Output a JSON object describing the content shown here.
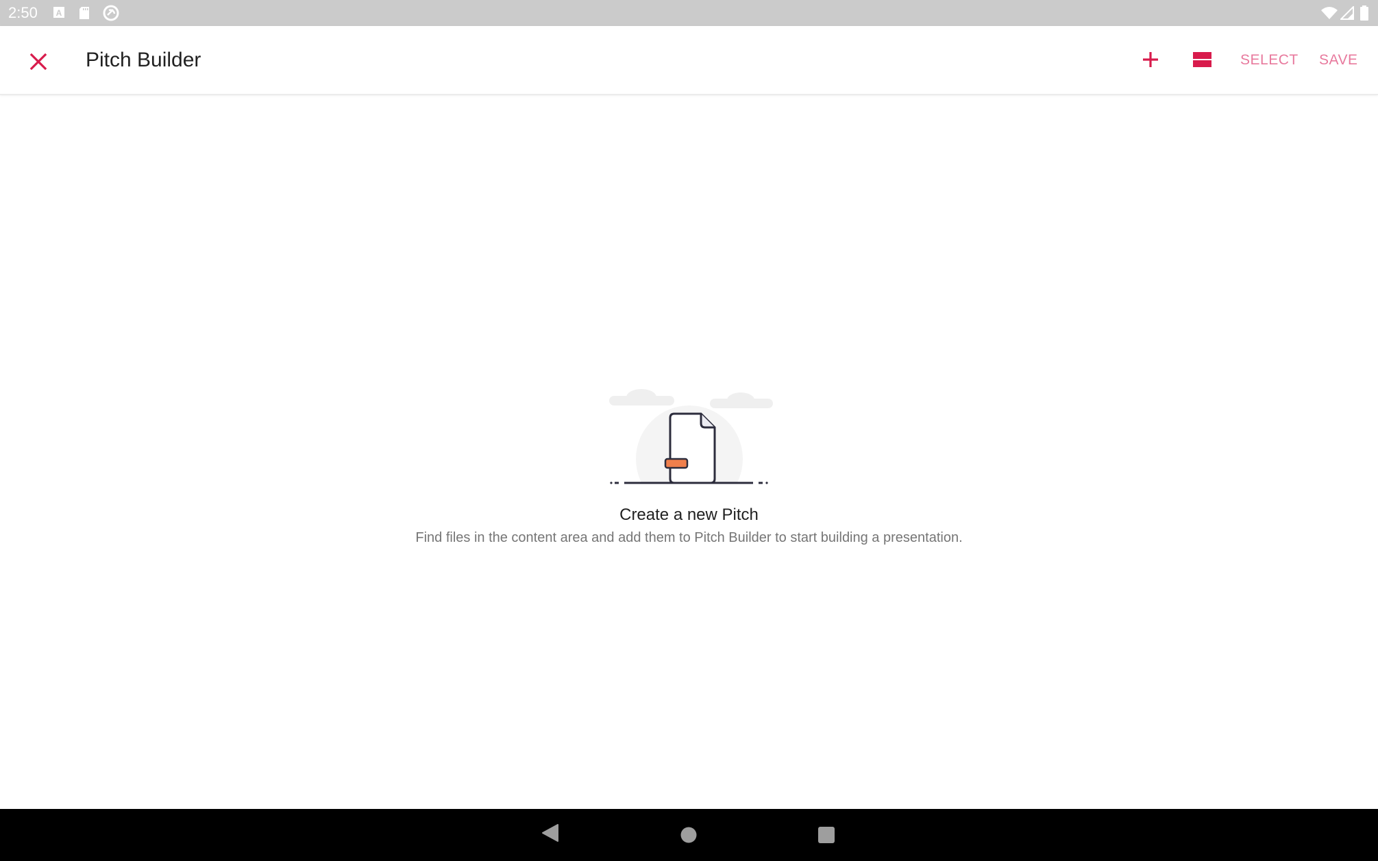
{
  "status_bar": {
    "time": "2:50",
    "left_icons": [
      "keyboard-a-icon",
      "sd-card-icon",
      "sync-disabled-icon"
    ],
    "right_icons": [
      "wifi-icon",
      "cell-signal-icon",
      "battery-icon"
    ]
  },
  "app_bar": {
    "title": "Pitch Builder",
    "close_icon": "close-icon",
    "actions": {
      "add_icon": "plus-icon",
      "layout_icon": "view-agenda-icon",
      "select_label": "SELECT",
      "save_label": "SAVE"
    }
  },
  "empty_state": {
    "illustration": "document-icon",
    "title": "Create a new Pitch",
    "description": "Find files in the content area and add them to Pitch Builder to start building a presentation."
  },
  "nav_bar": {
    "buttons": [
      "back-icon",
      "home-icon",
      "recents-icon"
    ]
  },
  "colors": {
    "accent": "#d81b4c",
    "accent_light": "#e8799d",
    "illustration_orange": "#f07f4c",
    "illustration_stroke": "#2c2c3c"
  }
}
